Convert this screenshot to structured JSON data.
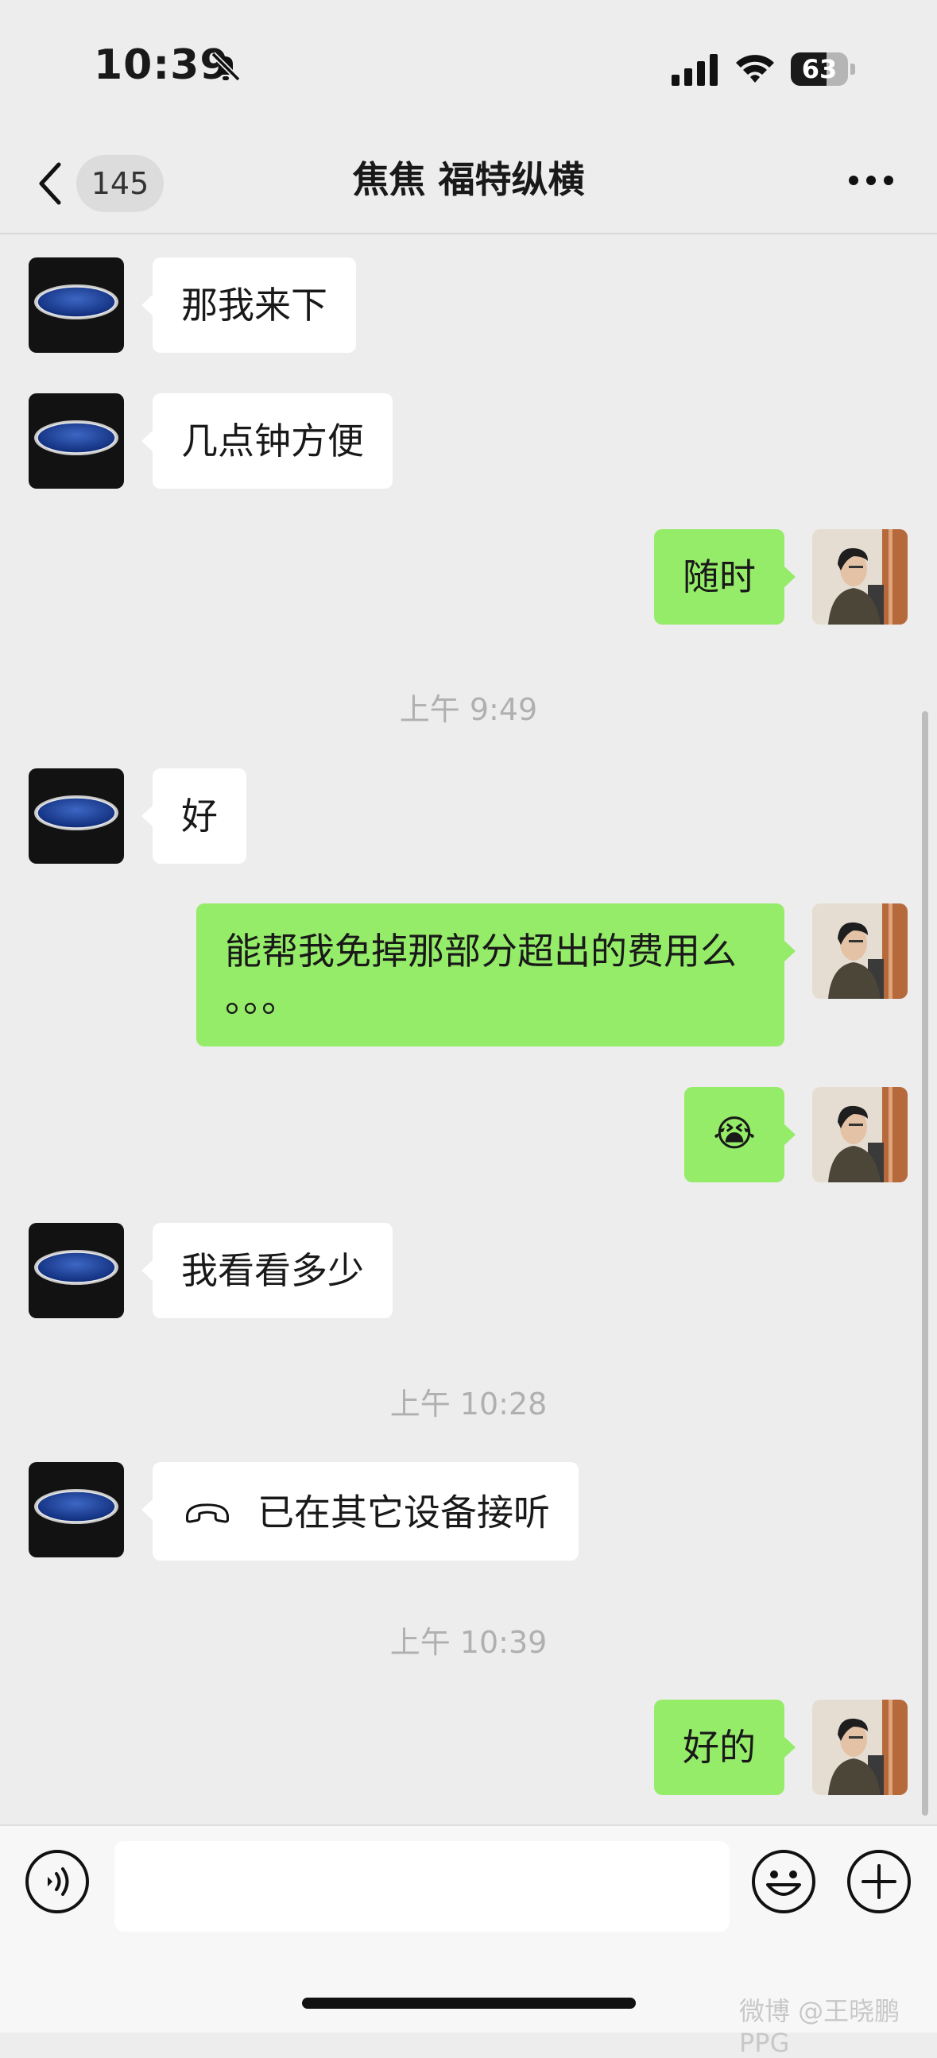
{
  "status_bar": {
    "time": "10:39",
    "battery": "63"
  },
  "nav": {
    "unread_count": "145",
    "title": "焦焦 福特纵横"
  },
  "contact_avatar_text": "Ford",
  "messages": {
    "m1": "那我来下",
    "m2": "几点钟方便",
    "m3": "随时",
    "ts1": "上午 9:49",
    "m4": "好",
    "m5_line1": "能帮我免掉那部分超出的费用么",
    "m5_line2": "。。。",
    "m6": "😭",
    "m7": "我看看多少",
    "ts2": "上午 10:28",
    "m8": "已在其它设备接听",
    "ts3": "上午 10:39",
    "m9": "好的"
  },
  "input": {
    "placeholder": "",
    "value": ""
  },
  "watermark": "微博 @王晓鹏PPG",
  "colors": {
    "bg": "#ededed",
    "bubble_out": "#95ec69",
    "bubble_in": "#ffffff",
    "timestamp": "#b0b0b0"
  }
}
